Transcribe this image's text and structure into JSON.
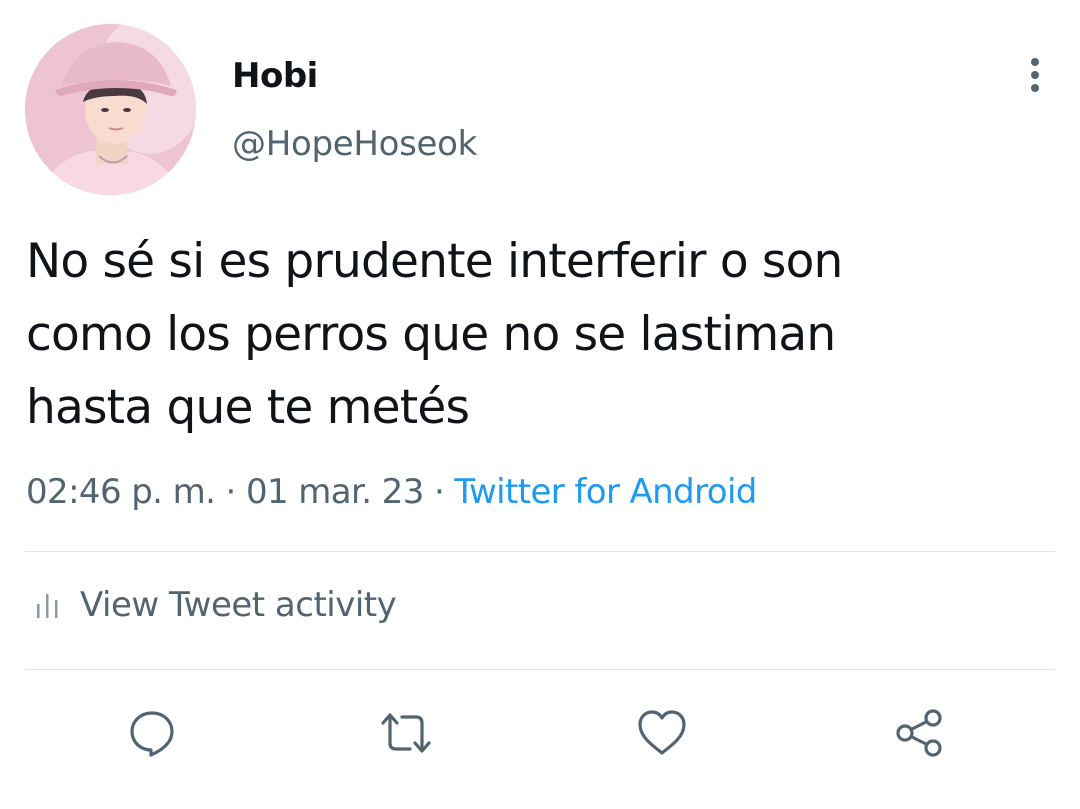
{
  "tweet": {
    "display_name": "Hobi",
    "handle": "@HopeHoseok",
    "text_lines": [
      "No sé si es prudente interferir o son",
      "como los perros que no se lastiman",
      "hasta que te metés"
    ],
    "time": "02:46 p. m.",
    "separator": "·",
    "date": "01 mar. 23",
    "source": "Twitter for Android"
  },
  "activity": {
    "label": "View Tweet activity",
    "icon": "bar-chart-icon"
  },
  "actions": [
    {
      "name": "reply",
      "icon": "comment-icon"
    },
    {
      "name": "retweet",
      "icon": "retweet-icon"
    },
    {
      "name": "like",
      "icon": "heart-icon"
    },
    {
      "name": "share",
      "icon": "share-icon"
    }
  ],
  "colors": {
    "text": "#0f1419",
    "secondary": "#536471",
    "link": "#1d9bf0",
    "divider": "#e1e6ea",
    "icon": "#536471"
  }
}
